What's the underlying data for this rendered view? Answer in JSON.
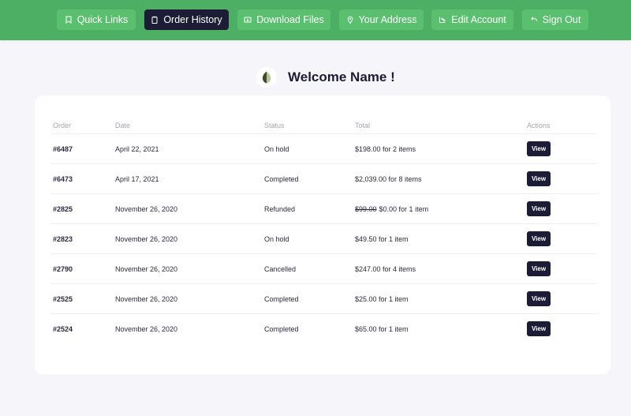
{
  "nav": {
    "items": [
      {
        "label": "Quick Links",
        "icon": "bookmark-icon",
        "active": false
      },
      {
        "label": "Order History",
        "icon": "clipboard-icon",
        "active": true
      },
      {
        "label": "Download Files",
        "icon": "download-icon",
        "active": false
      },
      {
        "label": "Your Address",
        "icon": "map-pin-icon",
        "active": false
      },
      {
        "label": "Edit Account",
        "icon": "edit-icon",
        "active": false
      },
      {
        "label": "Sign Out",
        "icon": "arrow-left-icon",
        "active": false
      }
    ]
  },
  "welcome": {
    "title": "Welcome Name !",
    "logo": "leaf-logo"
  },
  "orders": {
    "headers": {
      "order": "Order",
      "date": "Date",
      "status": "Status",
      "total": "Total",
      "actions": "Actions"
    },
    "rows": [
      {
        "id": "#6487",
        "date": "April 22, 2021",
        "status": "On hold",
        "old_total": "",
        "total": "$198.00 for 2 items",
        "action": "View"
      },
      {
        "id": "#6473",
        "date": "April 17, 2021",
        "status": "Completed",
        "old_total": "",
        "total": "$2,039.00 for 8 items",
        "action": "View"
      },
      {
        "id": "#2825",
        "date": "November 26, 2020",
        "status": "Refunded",
        "old_total": "$99.00",
        "total": "$0.00 for 1 item",
        "action": "View"
      },
      {
        "id": "#2823",
        "date": "November 26, 2020",
        "status": "On hold",
        "old_total": "",
        "total": "$49.50 for 1 item",
        "action": "View"
      },
      {
        "id": "#2790",
        "date": "November 26, 2020",
        "status": "Cancelled",
        "old_total": "",
        "total": "$247.00 for 4 items",
        "action": "View"
      },
      {
        "id": "#2525",
        "date": "November 26, 2020",
        "status": "Completed",
        "old_total": "",
        "total": "$25.00 for 1 item",
        "action": "View"
      },
      {
        "id": "#2524",
        "date": "November 26, 2020",
        "status": "Completed",
        "old_total": "",
        "total": "$65.00 for 1 item",
        "action": "View"
      }
    ]
  },
  "colors": {
    "header_bg": "#4caf64",
    "button_bg": "#5bbf70",
    "active_bg": "#1d1c37",
    "page_bg": "#f6f5f9"
  }
}
